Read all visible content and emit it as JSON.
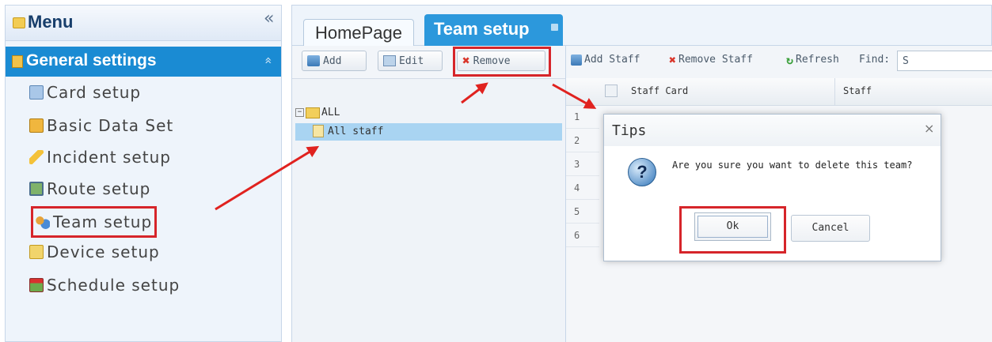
{
  "sidebar": {
    "menu_title": "Menu",
    "collapse_glyph": "«",
    "section_title": "General settings",
    "section_glyph": "»",
    "items": [
      {
        "label": "Card setup",
        "icon": "card-icon"
      },
      {
        "label": "Basic Data Set",
        "icon": "basic-data-icon"
      },
      {
        "label": "Incident setup",
        "icon": "incident-icon"
      },
      {
        "label": "Route setup",
        "icon": "route-icon"
      },
      {
        "label": "Team setup",
        "icon": "team-icon"
      },
      {
        "label": "Device setup",
        "icon": "device-icon"
      },
      {
        "label": "Schedule setup",
        "icon": "schedule-icon"
      }
    ]
  },
  "tabs": {
    "home": "HomePage",
    "team": "Team setup"
  },
  "tree_toolbar": {
    "add": "Add",
    "edit": "Edit",
    "remove": "Remove"
  },
  "tree": {
    "root": "ALL",
    "node": "All staff"
  },
  "grid_toolbar": {
    "add_staff": "Add Staff",
    "remove_staff": "Remove Staff",
    "refresh": "Refresh",
    "find": "Find:",
    "trailing": "S"
  },
  "grid": {
    "columns": [
      "Staff Card",
      "Staff"
    ],
    "row_numbers": [
      "1",
      "2",
      "3",
      "4",
      "5",
      "6"
    ]
  },
  "dialog": {
    "title": "Tips",
    "close_glyph": "×",
    "icon_glyph": "?",
    "message": "Are you sure you want to delete this team?",
    "ok": "Ok",
    "cancel": "Cancel"
  },
  "colors": {
    "accent": "#1a8bd3",
    "highlight": "#d6252a",
    "selection": "#a9d4f2"
  }
}
